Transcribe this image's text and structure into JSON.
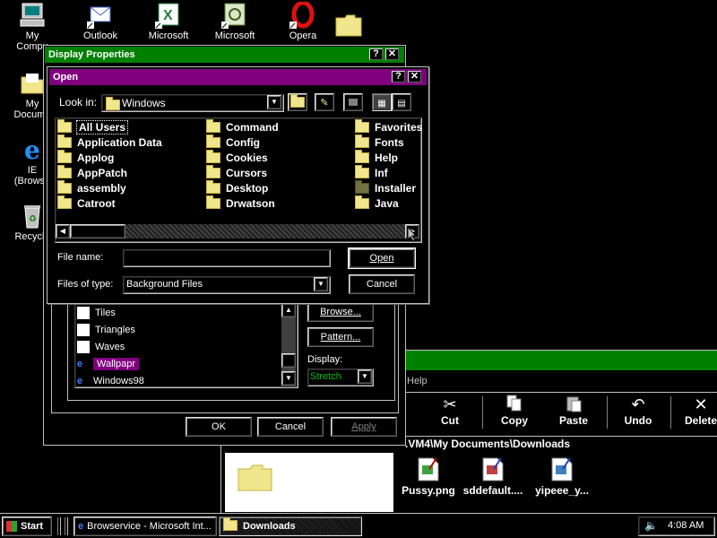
{
  "desktop": {
    "icons": [
      {
        "name": "my-computer",
        "label": "My\nCompu",
        "icon": "computer-icon"
      },
      {
        "name": "my-documents",
        "label": "My\nDocume",
        "icon": "folder-icon"
      },
      {
        "name": "ie-browser",
        "label": "IE\n(Browse",
        "icon": "ie-icon"
      },
      {
        "name": "recycle-bin",
        "label": "Recycle",
        "icon": "recycle-bin-icon"
      },
      {
        "name": "outlook",
        "label": "Outlook",
        "icon": "outlook-icon"
      },
      {
        "name": "microsoft-excel",
        "label": "Microsoft",
        "icon": "excel-icon"
      },
      {
        "name": "microsoft-project",
        "label": "Microsoft",
        "icon": "project-icon"
      },
      {
        "name": "opera",
        "label": "Opera",
        "icon": "opera-icon"
      }
    ]
  },
  "display_properties": {
    "title": "Display Properties",
    "wallpaper_list": [
      "Tiles",
      "Triangles",
      "Waves",
      "Wallpapr",
      "Windows98"
    ],
    "selected_wallpaper": "Wallpapr",
    "browse_label": "Browse...",
    "pattern_label": "Pattern...",
    "display_label": "Display:",
    "display_value": "Stretch",
    "ok_label": "OK",
    "cancel_label": "Cancel",
    "apply_label": "Apply"
  },
  "open_dialog": {
    "title": "Open",
    "look_in_label": "Look in:",
    "look_in_value": "Windows",
    "files": [
      {
        "name": "All Users"
      },
      {
        "name": "Application Data"
      },
      {
        "name": "Applog"
      },
      {
        "name": "AppPatch"
      },
      {
        "name": "assembly"
      },
      {
        "name": "Catroot"
      },
      {
        "name": "Command"
      },
      {
        "name": "Config"
      },
      {
        "name": "Cookies"
      },
      {
        "name": "Cursors"
      },
      {
        "name": "Desktop"
      },
      {
        "name": "Drwatson"
      },
      {
        "name": "Favorites"
      },
      {
        "name": "Fonts"
      },
      {
        "name": "Help"
      },
      {
        "name": "Inf"
      },
      {
        "name": "Installer"
      },
      {
        "name": "Java"
      }
    ],
    "file_name_label": "File name:",
    "file_name_value": "",
    "files_of_type_label": "Files of type:",
    "files_of_type_value": "Background Files",
    "open_label": "Open",
    "cancel_label": "Cancel"
  },
  "explorer": {
    "help_menu": "Help",
    "toolbar": [
      {
        "label": "Cut",
        "icon": "scissors-icon"
      },
      {
        "label": "Copy",
        "icon": "copy-icon"
      },
      {
        "label": "Paste",
        "icon": "paste-icon"
      },
      {
        "label": "Undo",
        "icon": "undo-icon"
      },
      {
        "label": "Delete",
        "icon": "delete-icon"
      }
    ],
    "address": ".VM4\\My Documents\\Downloads",
    "files": [
      {
        "label": "Pussy.png"
      },
      {
        "label": "sddefault...."
      },
      {
        "label": "yipeee_y..."
      }
    ]
  },
  "taskbar": {
    "start_label": "Start",
    "tasks": [
      {
        "label": "Browservice - Microsoft Int..."
      },
      {
        "label": "Downloads"
      }
    ],
    "clock": "4:08 AM"
  },
  "colors": {
    "open_titlebar": "#800080",
    "display_titlebar": "#008000",
    "explorer_titlebar": "#008000",
    "selection": "#800080"
  }
}
